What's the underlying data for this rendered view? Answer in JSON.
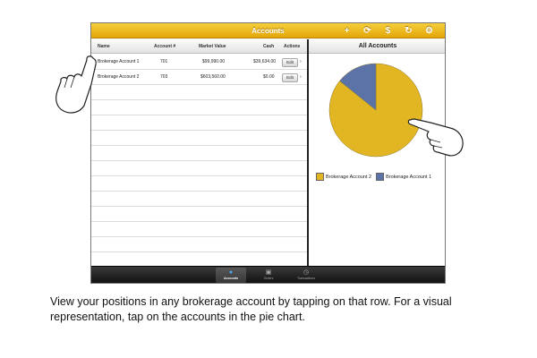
{
  "topbar": {
    "title": "Accounts",
    "icons": [
      {
        "name": "add-icon",
        "glyph": "+"
      },
      {
        "name": "refresh-accounts-icon",
        "glyph": "⟳"
      },
      {
        "name": "dollar-icon",
        "glyph": "$"
      },
      {
        "name": "reload-icon",
        "glyph": "↻"
      },
      {
        "name": "gear-icon",
        "glyph": "⚙"
      }
    ]
  },
  "accounts_table": {
    "headers": {
      "name": "Name",
      "account": "Account #",
      "market_value": "Market Value",
      "cash": "Cash",
      "actions": "Actions"
    },
    "rows": [
      {
        "name": "Brokerage Account 1",
        "account": "701",
        "market_value": "$99,990.00",
        "cash": "$39,634.00",
        "action": "Edit"
      },
      {
        "name": "Brokerage Account 2",
        "account": "703",
        "market_value": "$603,560.00",
        "cash": "$0.00",
        "action": "Edit"
      }
    ]
  },
  "right_panel": {
    "title": "All Accounts"
  },
  "chart_data": {
    "type": "pie",
    "title": "All Accounts",
    "slices": [
      {
        "label": "Brokerage Account 2",
        "value": 603560.0,
        "color": "#e2b522"
      },
      {
        "label": "Brokerage Account 1",
        "value": 99990.0,
        "color": "#5b73a6"
      }
    ],
    "legend_position": "bottom"
  },
  "tabbar": {
    "tabs": [
      {
        "label": "Accounts",
        "active": true
      },
      {
        "label": "Orders",
        "active": false
      },
      {
        "label": "Transactions",
        "active": false
      }
    ]
  },
  "colors": {
    "accent": "#f2b71a",
    "active_tab": "#4ea9ee"
  },
  "caption": "View your positions in any brokerage account by tapping on that row. For a visual representation, tap on the accounts in the pie chart."
}
